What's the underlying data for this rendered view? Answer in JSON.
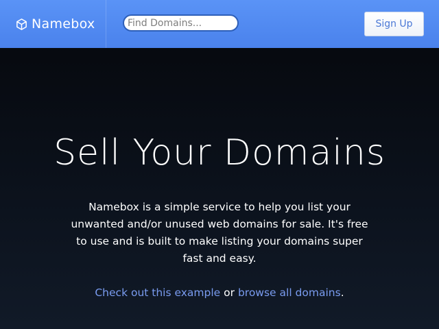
{
  "header": {
    "brand": {
      "name": "Namebox",
      "icon": "cube-icon"
    },
    "search": {
      "placeholder": "Find Domains...",
      "value": ""
    },
    "signup_label": "Sign Up"
  },
  "hero": {
    "title": "Sell Your Domains",
    "description": "Namebox is a simple service to help you list your unwanted and/or unused web domains for sale. It's free to use and is built to make listing your domains super fast and easy.",
    "links": {
      "example_text": "Check out this example",
      "connector": "or",
      "browse_text": "browse all domains",
      "suffix": "."
    }
  },
  "colors": {
    "header_bg": "#4f89f0",
    "page_bg": "#080c13",
    "link": "#7a9cf0",
    "button_text": "#4a78d6"
  }
}
